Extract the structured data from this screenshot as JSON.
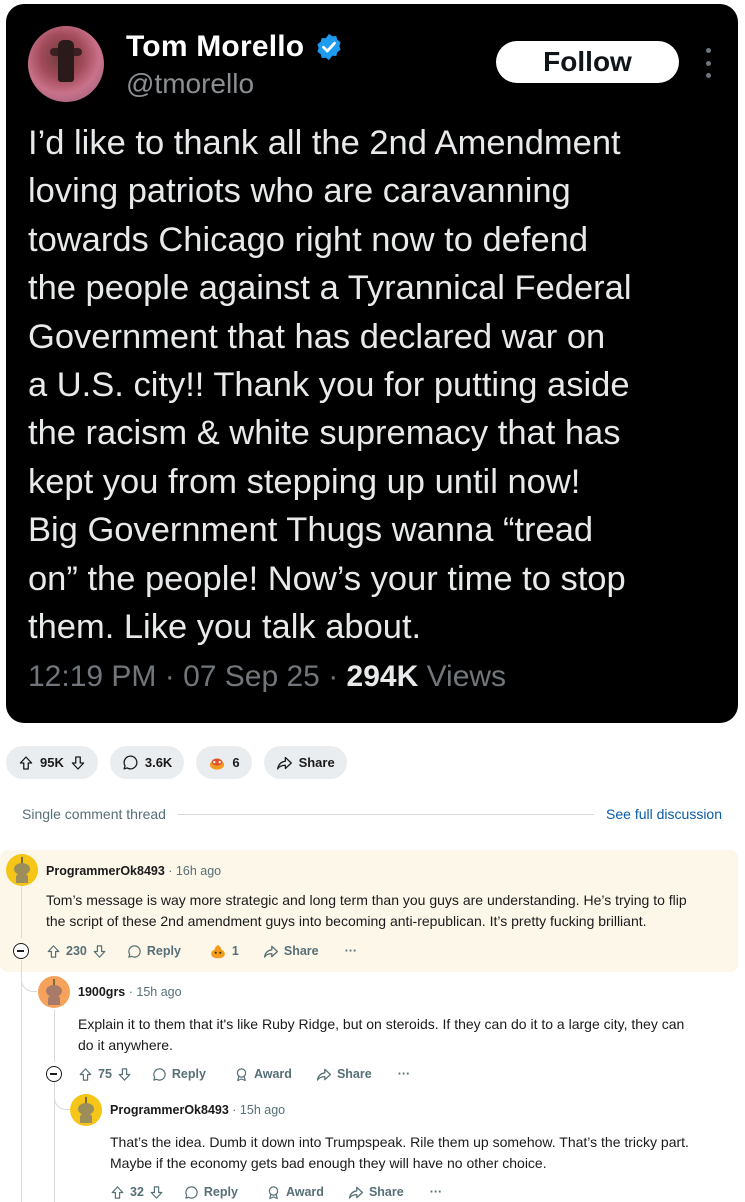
{
  "tweet": {
    "name": "Tom Morello",
    "handle": "@tmorello",
    "follow_label": "Follow",
    "lines": [
      "I’d like to thank all the 2nd Amendment",
      "loving patriots who are caravanning",
      "towards Chicago right now to defend",
      "the people against a Tyrannical Federal",
      "Government that has declared war on",
      "a U.S. city!! Thank you for putting aside",
      "the racism & white supremacy that has",
      "kept you from stepping up until now!",
      "Big Government Thugs wanna “tread",
      "on” the people! Now’s your time to stop",
      "them. Like you talk about."
    ],
    "time": "12:19 PM · 07 Sep 25 · ",
    "views_count": "294K",
    "views_label": " Views"
  },
  "post_actions": {
    "votes": "95K",
    "comments": "3.6K",
    "awards": "6",
    "share": "Share"
  },
  "thread": {
    "label": "Single comment thread",
    "full_link": "See full discussion"
  },
  "comments": [
    {
      "user": "ProgrammerOk8493",
      "time": " · 16h ago",
      "lines": [
        "Tom’s message is way more strategic and long term than you guys are understanding. He’s trying to flip",
        "the script of these 2nd amendment guys into becoming anti-republican. It’s pretty fucking brilliant."
      ],
      "votes": "230",
      "reply": "Reply",
      "award_count": "1",
      "share": "Share",
      "more": "···"
    },
    {
      "user": "1900grs",
      "time": " · 15h ago",
      "lines": [
        "Explain it to them that it's like Ruby Ridge, but on steroids. If they can do it to a large city, they can",
        "do it anywhere."
      ],
      "votes": "75",
      "reply": "Reply",
      "award": "Award",
      "share": "Share",
      "more": "···"
    },
    {
      "user": "ProgrammerOk8493",
      "time": " · 15h ago",
      "lines": [
        "That’s the idea. Dumb it down into Trumpspeak. Rile them up somehow. That’s the tricky part.",
        "Maybe if the economy gets bad enough they will have no other choice."
      ],
      "votes": "32",
      "reply": "Reply",
      "award": "Award",
      "share": "Share",
      "more": "···"
    }
  ]
}
